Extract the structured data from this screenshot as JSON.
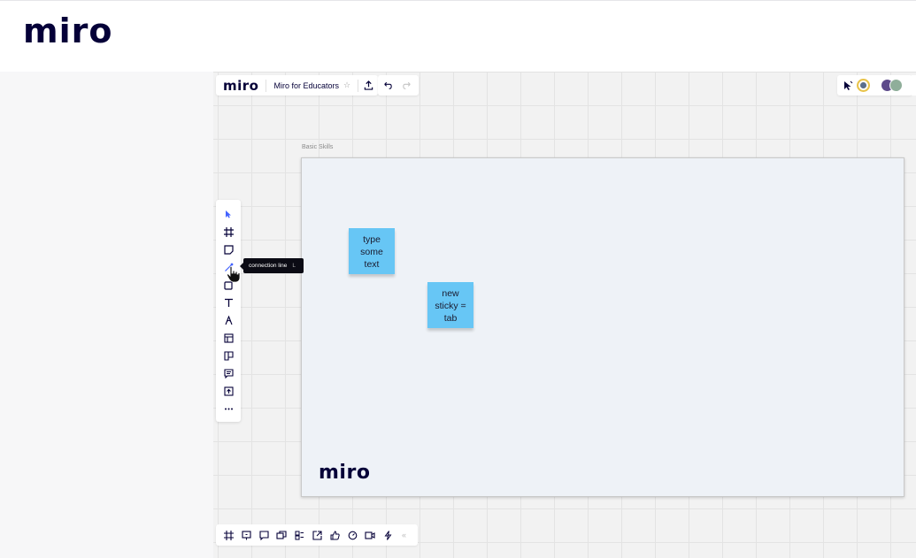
{
  "site": {
    "logo": "miro"
  },
  "board": {
    "logo": "miro",
    "title": "Miro for Educators",
    "star": "☆",
    "frame": {
      "label": "Basic Skills",
      "logo": "miro"
    },
    "stickies": [
      {
        "text": "type\nsome\ntext",
        "color": "#67c6f5"
      },
      {
        "text": "new\nsticky =\ntab",
        "color": "#67c6f5"
      }
    ],
    "tooltip": {
      "label": "connection line",
      "shortcut": "L"
    },
    "left_tools": [
      "select-icon",
      "frame-icon",
      "sticky-note-icon",
      "connection-line-icon",
      "shape-icon",
      "text-icon",
      "pen-icon",
      "template-icon",
      "card-icon",
      "comment-icon",
      "upload-icon",
      "more-icon"
    ],
    "bottom_tools": [
      "frames-icon",
      "presentation-icon",
      "comments-icon",
      "screen-share-icon",
      "cards-icon",
      "export-icon",
      "voting-icon",
      "timer-icon",
      "video-icon",
      "activity-icon"
    ],
    "collapse": "«"
  }
}
